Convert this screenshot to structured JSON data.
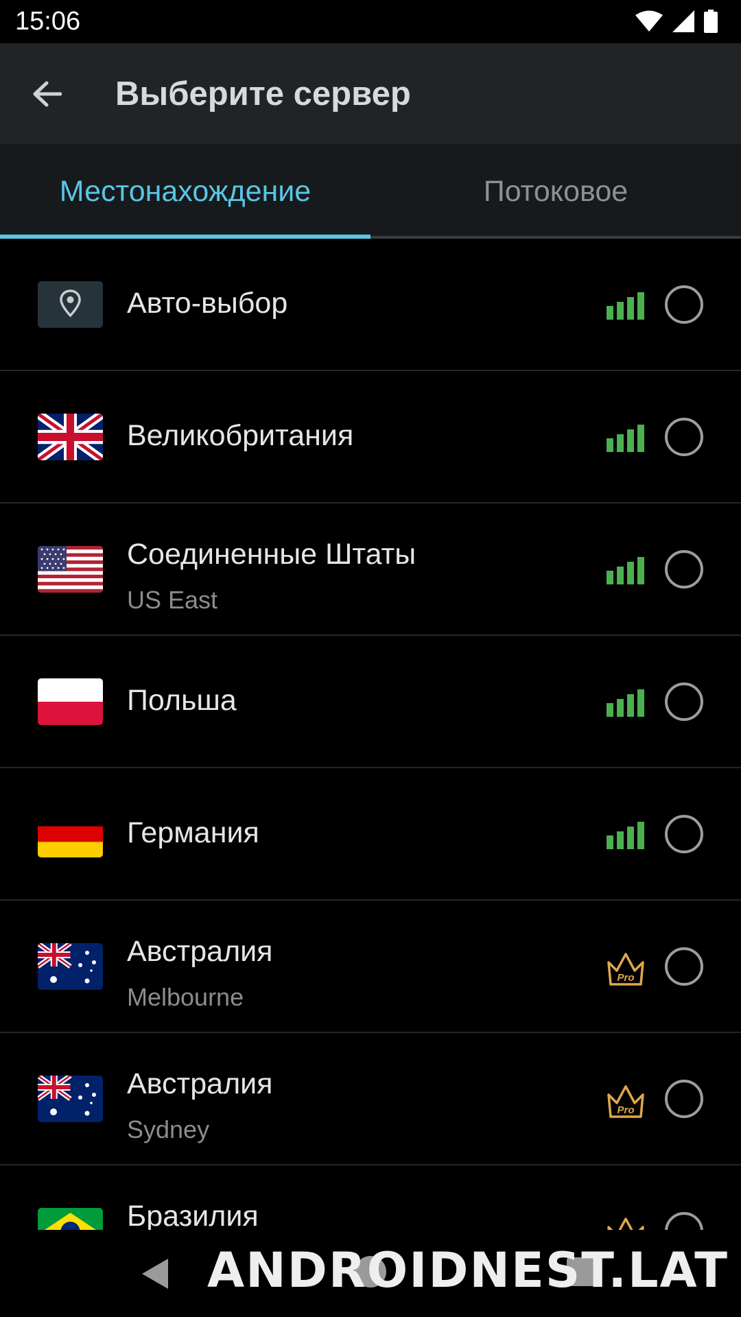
{
  "status_bar": {
    "time": "15:06",
    "icons": [
      "wifi-icon",
      "cell-signal-icon",
      "battery-icon"
    ]
  },
  "app_bar": {
    "back_icon": "arrow-left-icon",
    "title": "Выберите сервер"
  },
  "tabs": [
    {
      "label": "Местонахождение",
      "selected": true
    },
    {
      "label": "Потоковое",
      "selected": false
    }
  ],
  "servers": [
    {
      "name": "Авто-выбор",
      "sub": "",
      "flag": "location-pin",
      "badge": "signal",
      "selected": false
    },
    {
      "name": "Великобритания",
      "sub": "",
      "flag": "uk",
      "badge": "signal",
      "selected": false
    },
    {
      "name": "Соединенные Штаты",
      "sub": "US East",
      "flag": "us",
      "badge": "signal",
      "selected": false
    },
    {
      "name": "Польша",
      "sub": "",
      "flag": "pl",
      "badge": "signal",
      "selected": false
    },
    {
      "name": "Германия",
      "sub": "",
      "flag": "de",
      "badge": "signal",
      "selected": false
    },
    {
      "name": "Австралия",
      "sub": "Melbourne",
      "flag": "au",
      "badge": "pro",
      "selected": false
    },
    {
      "name": "Австралия",
      "sub": "Sydney",
      "flag": "au",
      "badge": "pro",
      "selected": false
    },
    {
      "name": "Бразилия",
      "sub": "",
      "flag": "br",
      "badge": "pro",
      "selected": false
    }
  ],
  "pro_badge_text": "Pro",
  "colors": {
    "accent": "#58c6e6",
    "signal": "#4caf50",
    "pro": "#e0a84a",
    "background": "#000000",
    "app_bar": "#212427"
  },
  "nav_bar": {
    "icons": [
      "nav-back-icon",
      "nav-home-icon",
      "nav-recents-icon"
    ]
  },
  "watermark": "ANDROIDNEST.LAT"
}
